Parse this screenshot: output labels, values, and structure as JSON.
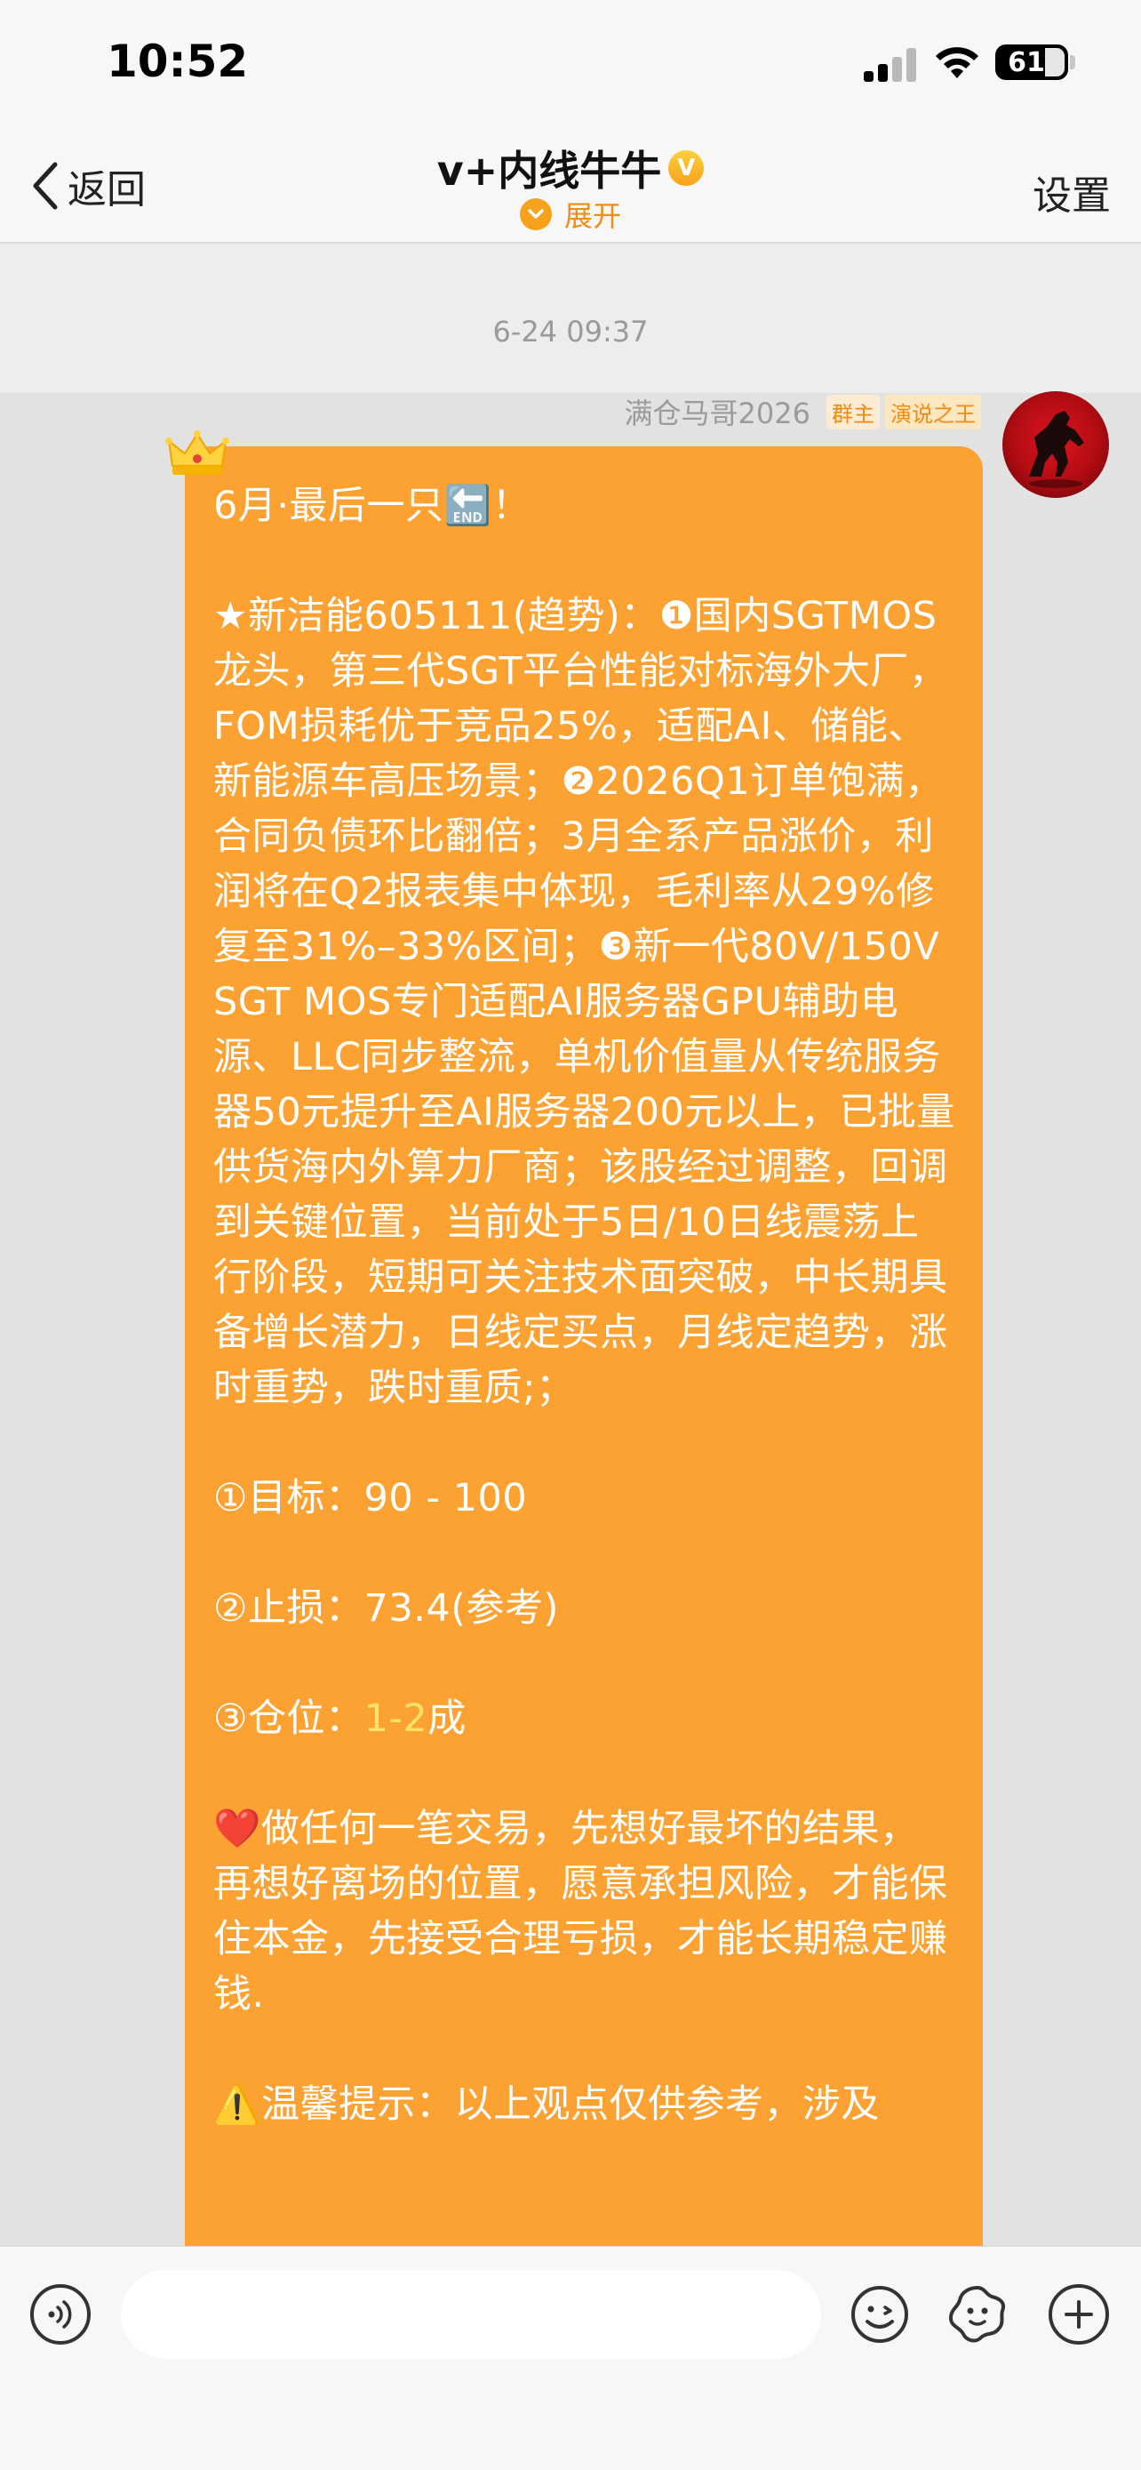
{
  "status_bar": {
    "time": "10:52",
    "battery": "61"
  },
  "nav": {
    "back_label": "返回",
    "title": "v+内线牛牛",
    "vip_badge": "V",
    "expand_label": "展开",
    "settings_label": "设置"
  },
  "chat": {
    "timestamp": "6-24 09:37",
    "sender": {
      "name": "满仓马哥2026",
      "tags": [
        "群主",
        "演说之王"
      ]
    },
    "message": {
      "line_title": "6月·最后一只🔚！",
      "para_main": "★新洁能605111(趋势)：❶国内SGTMOS龙头，第三代SGT平台性能对标海外大厂，FOM损耗优于竞品25%，适配AI、储能、新能源车高压场景；❷2026Q1订单饱满，合同负债环比翻倍；3月全系产品涨价，利润将在Q2报表集中体现，毛利率从29%修复至31%–33%区间；❸新一代80V/150V SGT MOS专门适配AI服务器GPU辅助电源、LLC同步整流，单机价值量从传统服务器50元提升至AI服务器200元以上，已批量供货海内外算力厂商；该股经过调整，回调到关键位置，当前处于5日/10日线震荡上行阶段，短期可关注技术面突破，中长期具备增长潜力，日线定买点，月线定趋势，涨时重势，跌时重质;；",
      "target": "①目标：90 - 100",
      "stoploss": "②止损：73.4(参考)",
      "position_prefix": "③仓位：",
      "position_value": "1-2",
      "position_suffix": "成",
      "risk_note": "❤️做任何一笔交易，先想好最坏的结果，再想好离场的位置，愿意承担风险，才能保住本金，先接受合理亏损，才能长期稳定赚钱.",
      "warning_partial": "⚠️温馨提示：以上观点仅供参考，涉及"
    }
  },
  "input": {
    "placeholder": ""
  },
  "colors": {
    "bubble": "#fca233",
    "accent": "#f7a21b",
    "highlight": "#ffe26a"
  },
  "icons": [
    "voice-icon",
    "emoji-icon",
    "sticker-icon",
    "plus-icon",
    "crown-icon",
    "back-chevron-icon"
  ]
}
